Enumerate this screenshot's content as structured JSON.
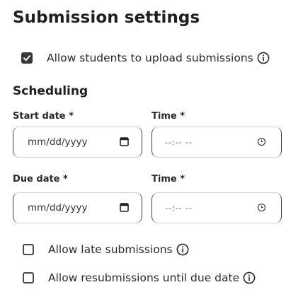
{
  "title": "Submission settings",
  "upload": {
    "label": "Allow students to upload submissions",
    "checked": true
  },
  "scheduling": {
    "heading": "Scheduling",
    "start": {
      "date_label": "Start date *",
      "date_value": "mm/dd/yyyy",
      "time_label": "Time *",
      "time_value": "--:-- --"
    },
    "due": {
      "date_label": "Due date *",
      "date_value": "mm/dd/yyyy",
      "time_label": "Time *",
      "time_value": "--:-- --"
    }
  },
  "late": {
    "label": "Allow late submissions",
    "checked": false
  },
  "resubmit": {
    "label": "Allow resubmissions until due date",
    "checked": false
  },
  "icons": {
    "info": "info-circle-icon",
    "calendar": "calendar-icon",
    "clock": "clock-icon",
    "check": "checkmark-icon"
  }
}
